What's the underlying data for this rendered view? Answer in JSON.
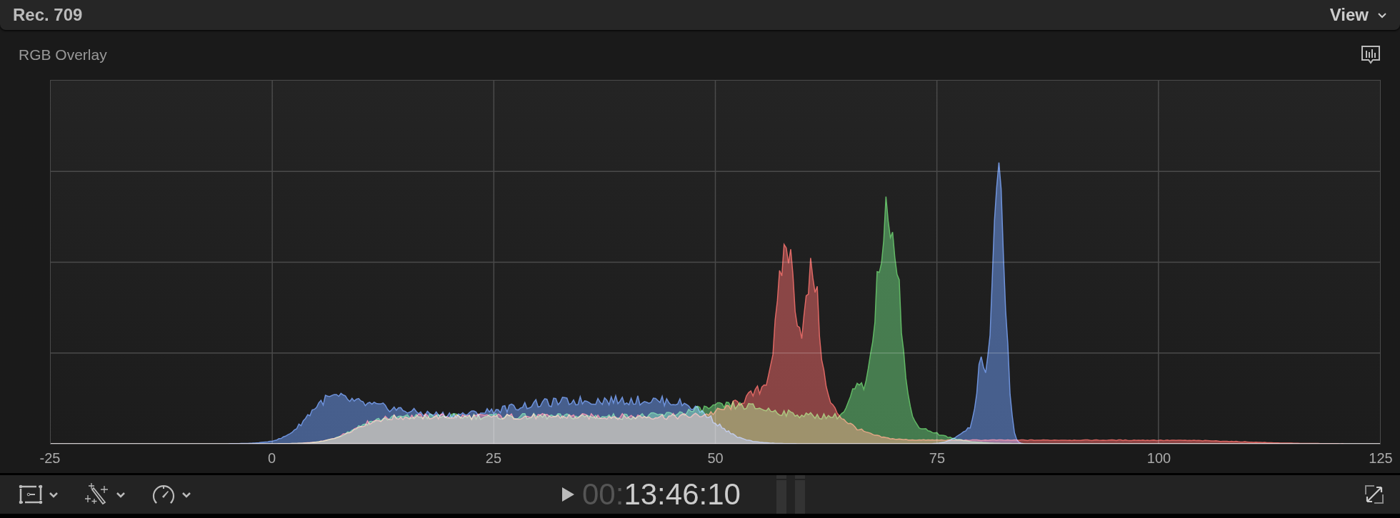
{
  "header": {
    "title": "Rec. 709",
    "view_menu": "View"
  },
  "scope": {
    "title": "RGB Overlay",
    "x_labels": [
      "-25",
      "0",
      "25",
      "50",
      "75",
      "100",
      "125"
    ]
  },
  "toolbar": {
    "timecode_dim": "00:",
    "timecode": "13:46:10"
  }
}
